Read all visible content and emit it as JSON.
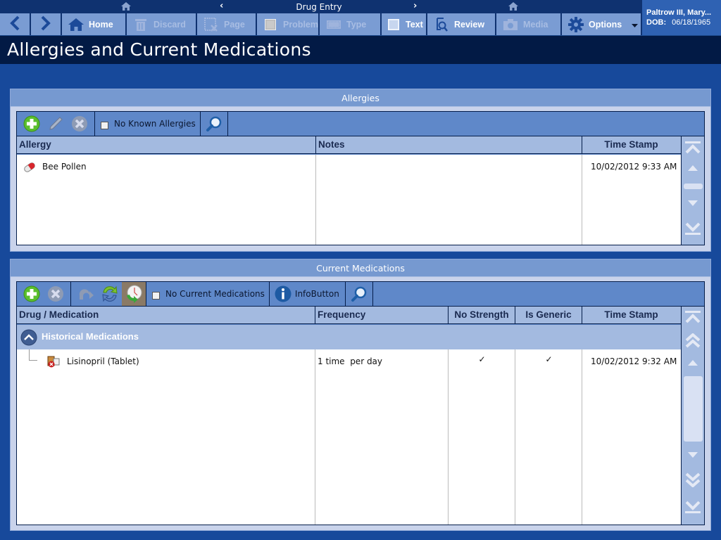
{
  "topnav": {
    "title": "Drug Entry",
    "prev_arrow": "‹",
    "next_arrow": "›"
  },
  "toolbar": {
    "back": {
      "icon": "back-arrow-icon"
    },
    "forward": {
      "icon": "forward-arrow-icon"
    },
    "buttons": [
      {
        "label": "Home",
        "icon": "home-icon",
        "enabled": true
      },
      {
        "label": "Discard",
        "icon": "trash-icon",
        "enabled": false
      },
      {
        "label": "Page",
        "icon": "page-cancel-icon",
        "enabled": false
      },
      {
        "label": "Problem",
        "icon": "checkbox-icon",
        "enabled": false
      },
      {
        "label": "Type",
        "icon": "keyboard-icon",
        "enabled": false
      },
      {
        "label": "Text",
        "icon": "checkbox-icon",
        "enabled": true
      },
      {
        "label": "Review",
        "icon": "review-search-icon",
        "enabled": true
      },
      {
        "label": "Media",
        "icon": "camera-icon",
        "enabled": false
      },
      {
        "label": "Options",
        "icon": "gear-icon",
        "enabled": true
      }
    ]
  },
  "patient": {
    "name": "Paltrow III, Mary...",
    "dob_label": "DOB:",
    "dob": "06/18/1965"
  },
  "page_title": "Allergies and Current Medications",
  "allergies": {
    "title": "Allergies",
    "no_known_label": "No Known Allergies",
    "no_known_checked": false,
    "columns": [
      "Allergy",
      "Notes",
      "Time Stamp"
    ],
    "rows": [
      {
        "allergy": "Bee Pollen",
        "notes": "",
        "timestamp": "10/02/2012 9:33 AM",
        "icon": "pill-capsule-icon"
      }
    ]
  },
  "medications": {
    "title": "Current Medications",
    "no_current_label": "No Current Medications",
    "no_current_checked": false,
    "info_button_label": "InfoButton",
    "columns": [
      "Drug / Medication",
      "Frequency",
      "No Strength",
      "Is Generic",
      "Time Stamp"
    ],
    "group_label": "Historical Medications",
    "rows": [
      {
        "drug": "Lisinopril (Tablet)",
        "frequency": "1 time  per day",
        "no_strength": "✓",
        "is_generic": "✓",
        "timestamp": "10/02/2012 9:32 AM",
        "icon": "discontinued-med-icon"
      }
    ]
  }
}
